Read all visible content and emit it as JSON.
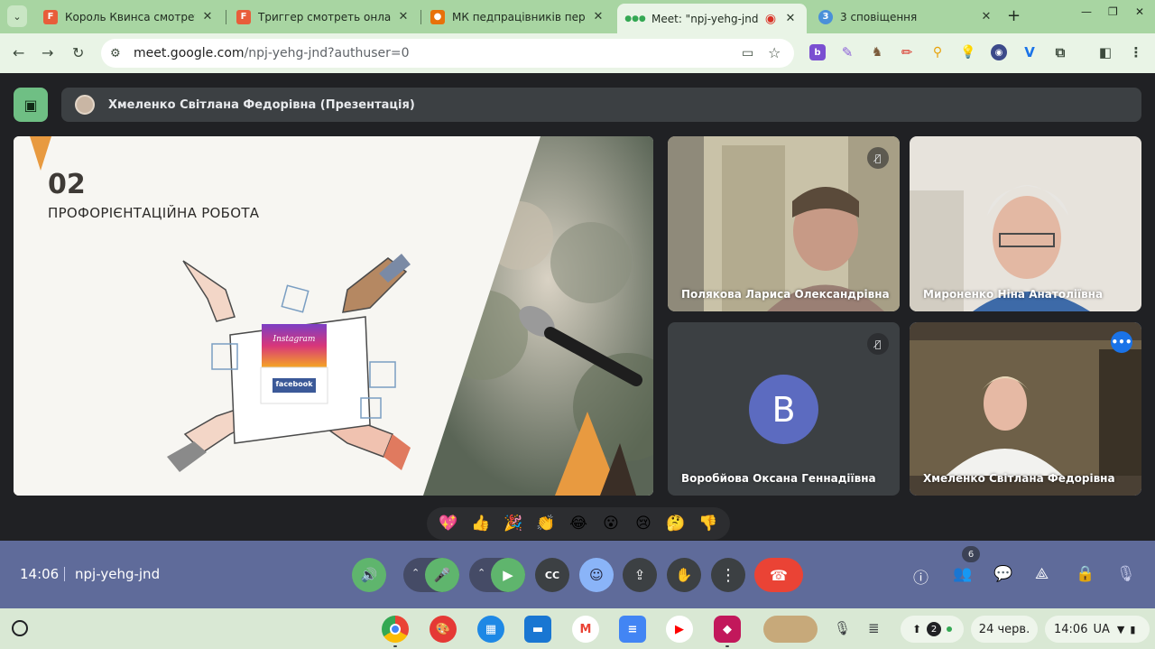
{
  "browser": {
    "tabs": [
      {
        "title": "Король Квинса смотреть о",
        "favicon": "F",
        "favicon_color": "#e85d3a"
      },
      {
        "title": "Триггер смотреть онлайн с",
        "favicon": "F",
        "favicon_color": "#e85d3a"
      },
      {
        "title": "МК педпрацівників перукар",
        "favicon": "person-icon",
        "favicon_color": "#e8710a"
      },
      {
        "title": "Meet: \"npj-yehg-jnd\"",
        "favicon": "meet-dots-icon",
        "favicon_color": "#34a853",
        "active": true
      },
      {
        "title": "3 сповіщення",
        "favicon": "3",
        "favicon_color": "#4a90d9"
      }
    ],
    "url_host": "meet.google.com",
    "url_path": "/npj-yehg-jnd?authuser=0"
  },
  "meet": {
    "presenter_bar": "Хмеленко Світлана Федорівна (Презентація)",
    "slide": {
      "number": "02",
      "heading": "ПРОФОРІЄНТАЦІЙНА РОБОТА",
      "instagram": "Instagram",
      "facebook": "facebook"
    },
    "participants": [
      {
        "name": "Полякова Лариса Олександрівна",
        "muted": true
      },
      {
        "name": "Мироненко Ніна Анатоліївна",
        "muted": false
      },
      {
        "name": "Воробйова Оксана Геннадіївна",
        "muted": true,
        "initial": "B",
        "avatar_color": "#5c6bc0"
      },
      {
        "name": "Хмеленко Світлана Федорівна",
        "muted": false,
        "active": true
      }
    ],
    "reactions": [
      "💖",
      "👍",
      "🎉",
      "👏",
      "😂",
      "😮",
      "😢",
      "🤔",
      "👎"
    ],
    "controls": {
      "time": "14:06",
      "meeting_code": "npj-yehg-jnd",
      "people_count": "6"
    }
  },
  "shelf": {
    "date": "24 черв.",
    "time": "14:06",
    "locale": "UA",
    "notification_count": "2"
  }
}
